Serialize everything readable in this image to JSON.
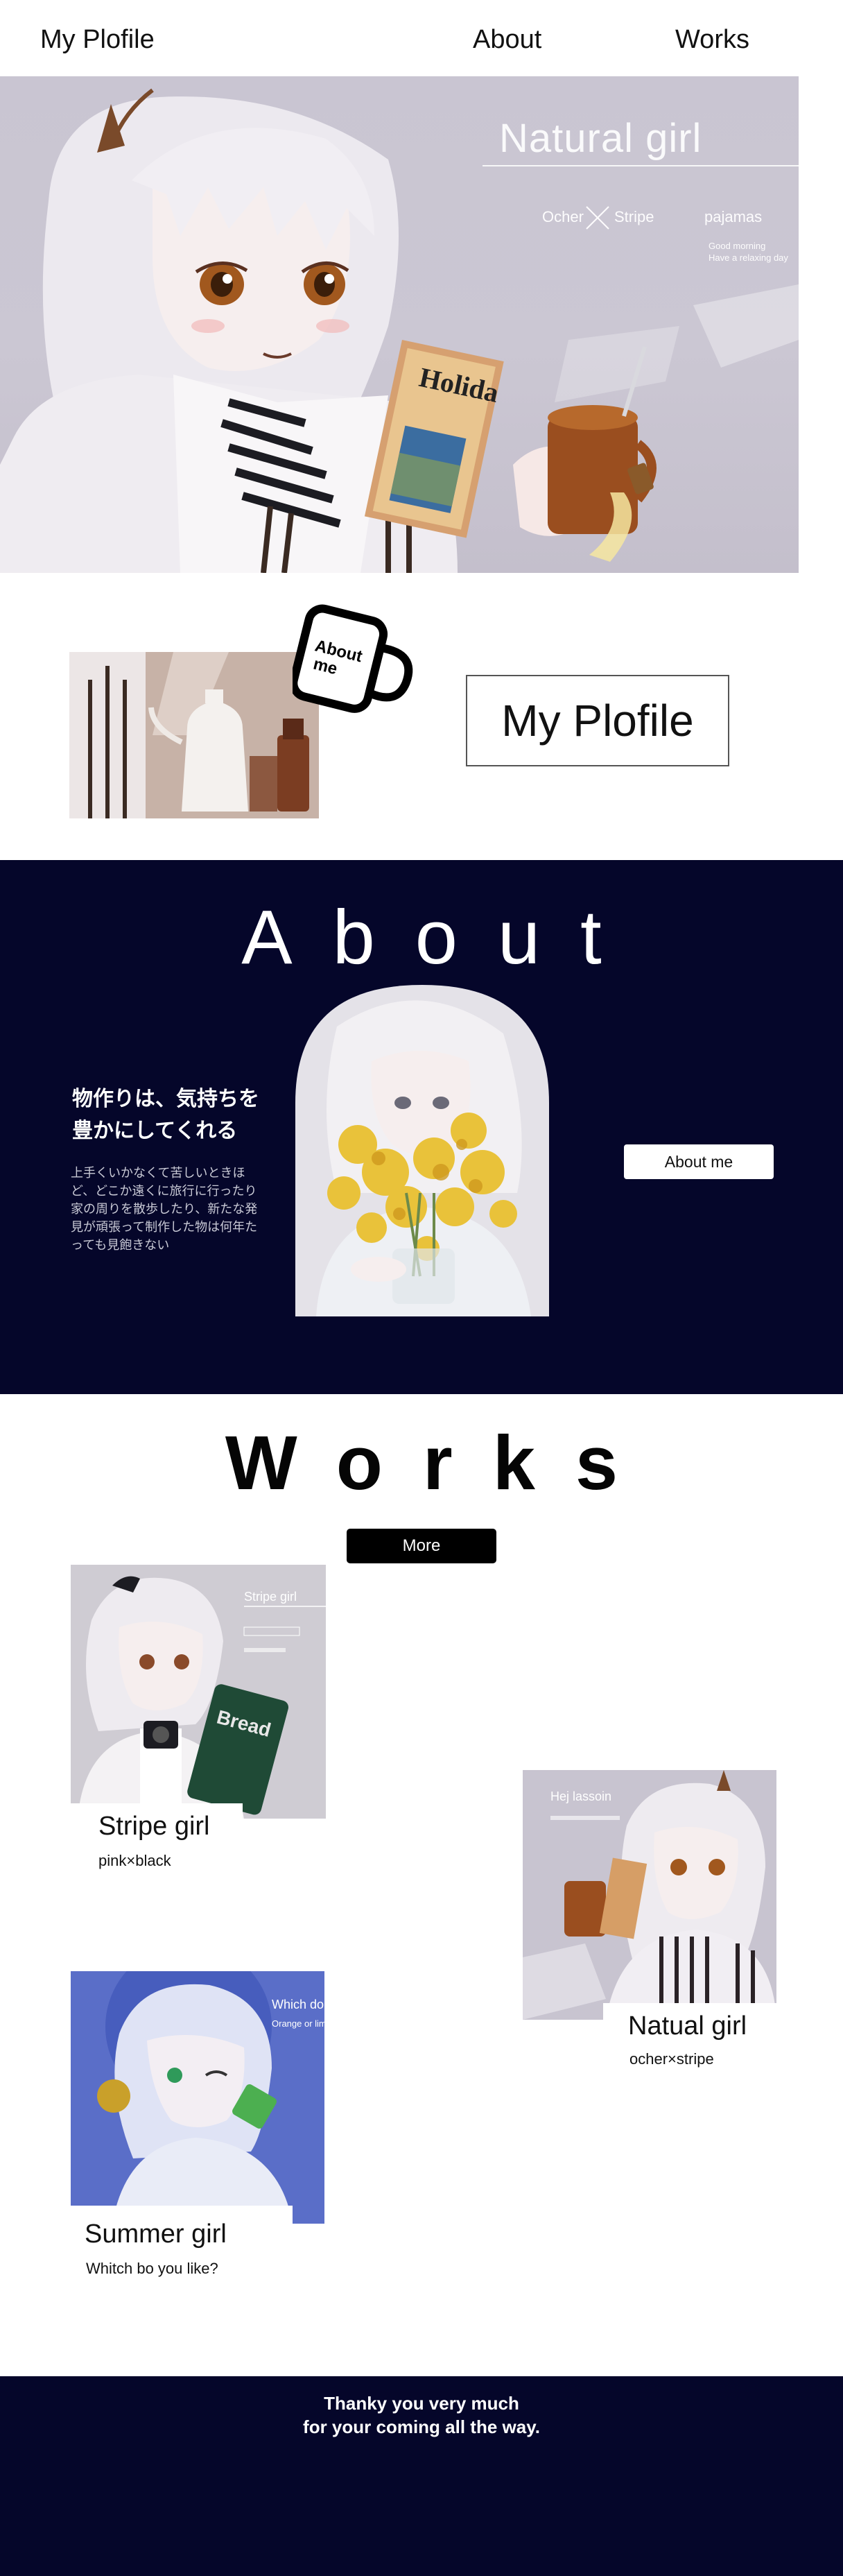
{
  "header": {
    "logo": "My Plofile",
    "nav": {
      "about": "About",
      "works": "Works"
    }
  },
  "hero": {
    "title": "Natural girl",
    "tag_left": "Ocher",
    "tag_right": "Stripe",
    "tag_item": "pajamas",
    "caption_line1": "Good morning",
    "caption_line2": "Have a relaxing day",
    "book_text": "Holida"
  },
  "profile": {
    "badge_line1": "About",
    "badge_line2": "me",
    "title": "My Plofile"
  },
  "about": {
    "heading": "About",
    "catch_line1": "物作りは、気持ちを",
    "catch_line2": "豊かにしてくれる",
    "body": "上手くいかなくて苦しいときほど、どこか遠くに旅行に行ったり家の周りを散歩したり、新たな発見が頑張って制作した物は何年たっても見飽きない",
    "button": "About me"
  },
  "works": {
    "heading": "Works",
    "more": "More",
    "items": [
      {
        "title": "Stripe girl",
        "subtitle": "pink×black",
        "img_text": "Stripe girl",
        "prop_text": "Bread"
      },
      {
        "title": "Natual girl",
        "subtitle": "ocher×stripe",
        "img_text": "Hej lassoin"
      },
      {
        "title": "Summer girl",
        "subtitle": "Whitch bo you like?",
        "img_text": "Which do",
        "img_text2": "Orange or lim"
      }
    ]
  },
  "footer": {
    "line1": "Thanky you very much",
    "line2": "for your coming all the way."
  },
  "colors": {
    "navy": "#05062a",
    "hero_bg": "#c9c5d2",
    "ocher": "#a0542a",
    "mimosa": "#e9c23a"
  }
}
